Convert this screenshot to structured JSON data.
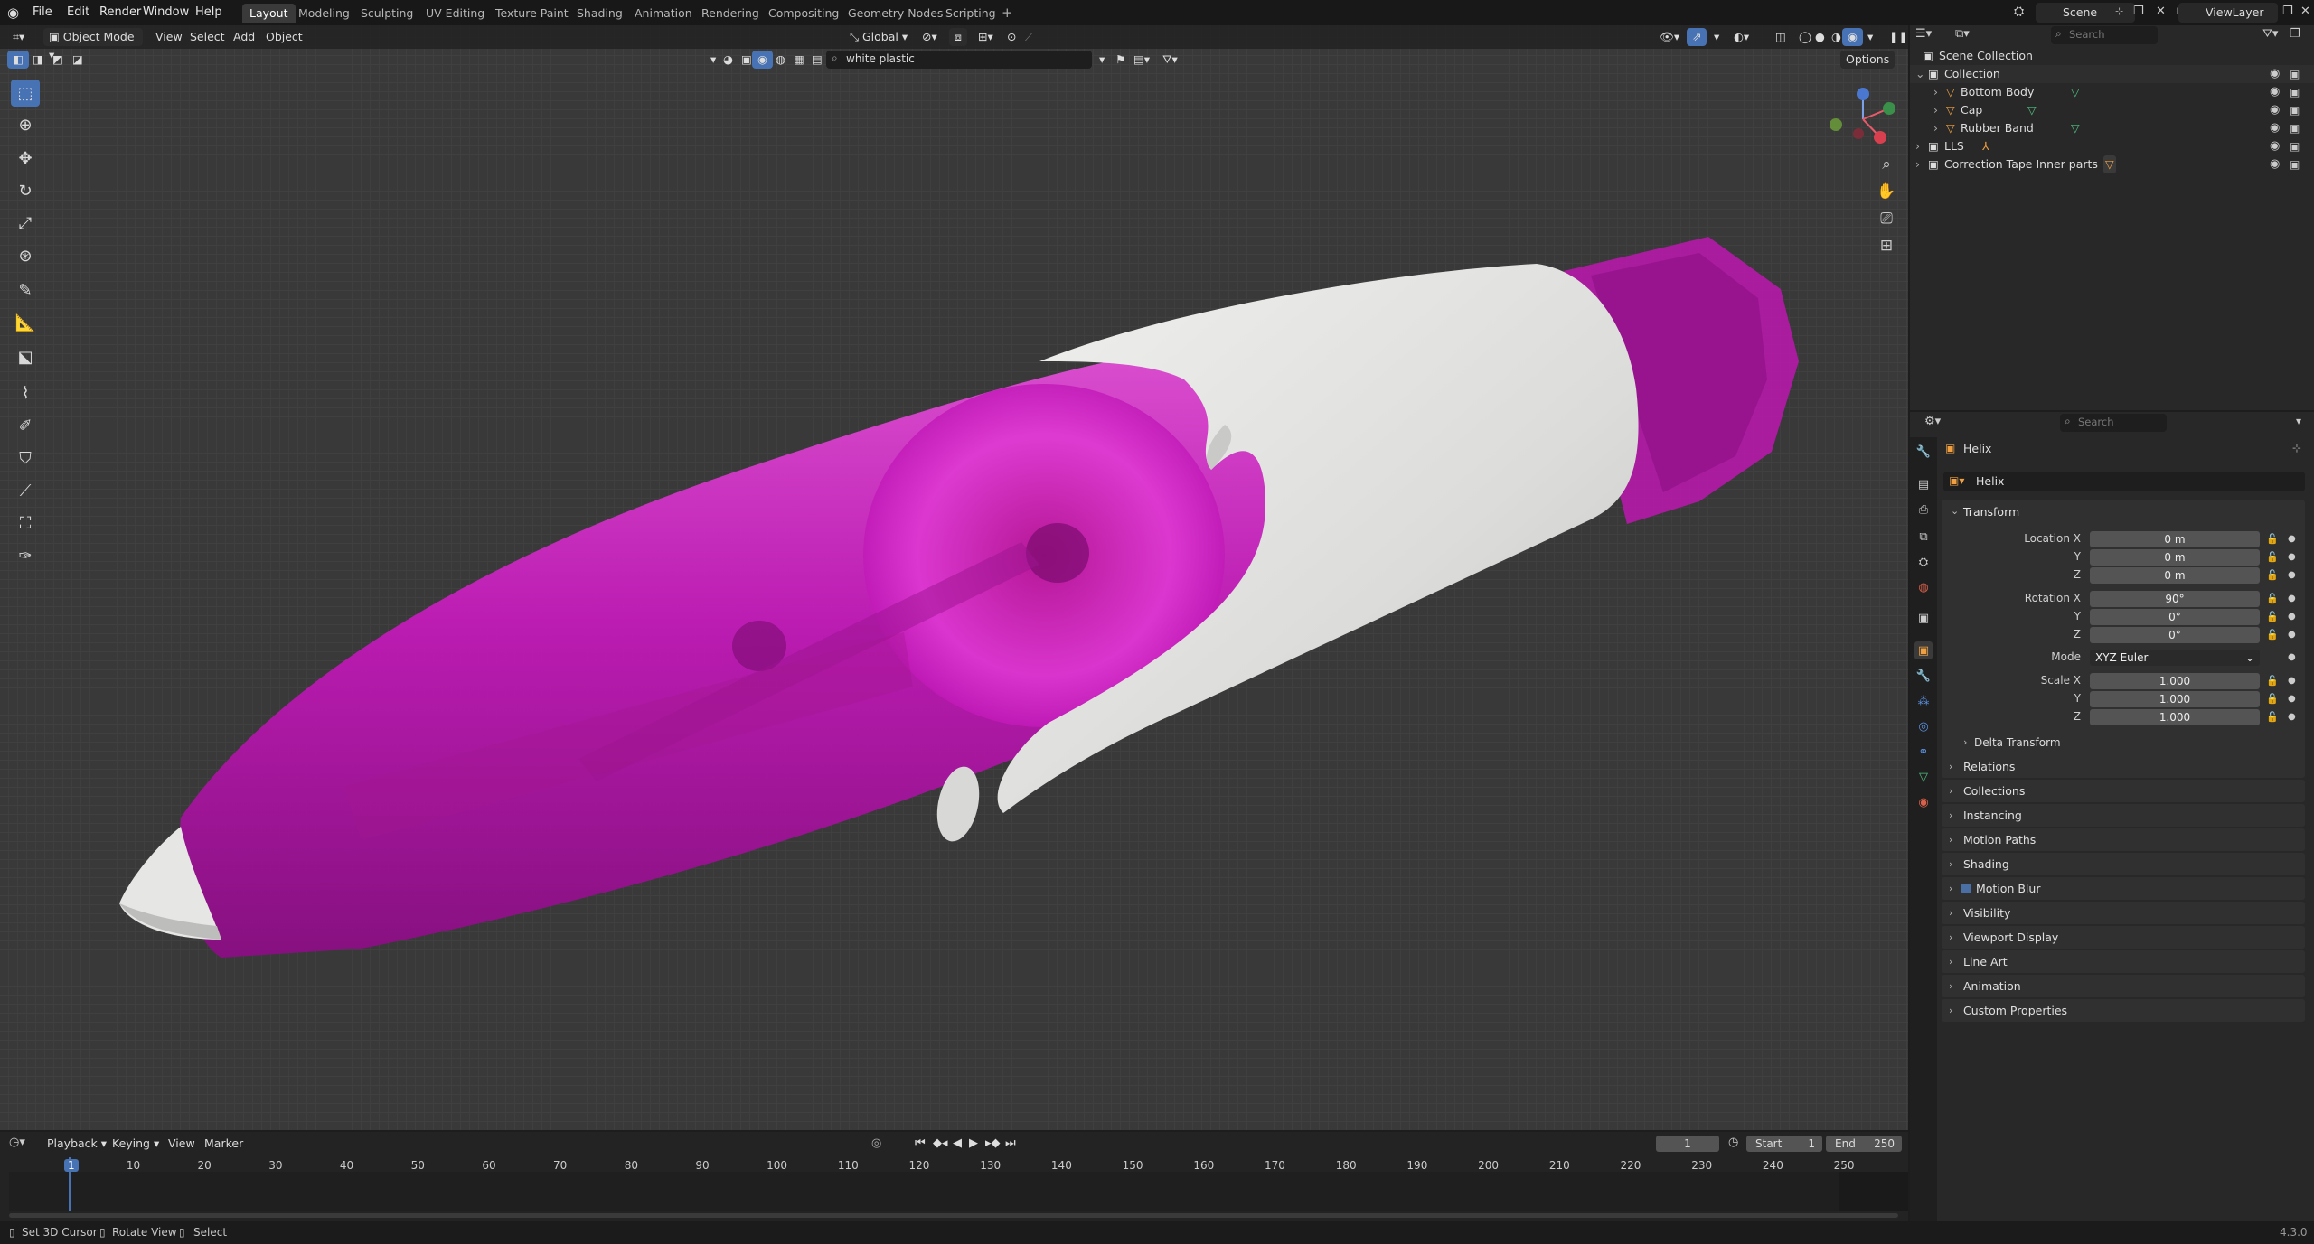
{
  "topbar": {
    "menus": [
      "File",
      "Edit",
      "Render",
      "Window",
      "Help"
    ],
    "workspaces": [
      "Layout",
      "Modeling",
      "Sculpting",
      "UV Editing",
      "Texture Paint",
      "Shading",
      "Animation",
      "Rendering",
      "Compositing",
      "Geometry Nodes",
      "Scripting"
    ],
    "active_workspace": "Layout",
    "scene": "Scene",
    "view_layer": "ViewLayer"
  },
  "viewport_header": {
    "mode": "Object Mode",
    "menus": [
      "View",
      "Select",
      "Add",
      "Object"
    ],
    "orientation": "Global",
    "options": "Options",
    "material_search": "white plastic"
  },
  "outliner": {
    "search_placeholder": "Search",
    "rows": [
      {
        "label": "Scene Collection"
      },
      {
        "label": "Collection"
      },
      {
        "label": "Bottom Body"
      },
      {
        "label": "Cap"
      },
      {
        "label": "Rubber Band"
      },
      {
        "label": "LLS"
      },
      {
        "label": "Correction Tape Inner parts"
      }
    ]
  },
  "properties": {
    "search_placeholder": "Search",
    "object_name": "Helix",
    "data_name": "Helix",
    "transform_title": "Transform",
    "location": {
      "label": "Location X",
      "x": "0 m",
      "y": "0 m",
      "z": "0 m"
    },
    "rotation": {
      "label": "Rotation X",
      "x": "90°",
      "y": "0°",
      "z": "0°"
    },
    "mode": {
      "label": "Mode",
      "value": "XYZ Euler"
    },
    "scale": {
      "label": "Scale X",
      "x": "1.000",
      "y": "1.000",
      "z": "1.000"
    },
    "axis_y": "Y",
    "axis_z": "Z",
    "delta_transform": "Delta Transform",
    "panels": [
      "Relations",
      "Collections",
      "Instancing",
      "Motion Paths",
      "Shading",
      "Motion Blur",
      "Visibility",
      "Viewport Display",
      "Line Art",
      "Animation",
      "Custom Properties"
    ]
  },
  "timeline": {
    "menus": [
      "Playback",
      "Keying",
      "View",
      "Marker"
    ],
    "current_frame": "1",
    "start_label": "Start",
    "start": "1",
    "end_label": "End",
    "end": "250",
    "frames": [
      "1",
      "10",
      "20",
      "30",
      "40",
      "50",
      "60",
      "70",
      "80",
      "90",
      "100",
      "110",
      "120",
      "130",
      "140",
      "150",
      "160",
      "170",
      "180",
      "190",
      "200",
      "210",
      "220",
      "230",
      "240",
      "250"
    ]
  },
  "statusbar": {
    "items": [
      "Set 3D Cursor",
      "Rotate View",
      "Select"
    ],
    "version": "4.3.0"
  },
  "colors": {
    "accent": "#4772b3",
    "magenta": "#c21ab8",
    "white_plastic": "#e2e2df"
  }
}
